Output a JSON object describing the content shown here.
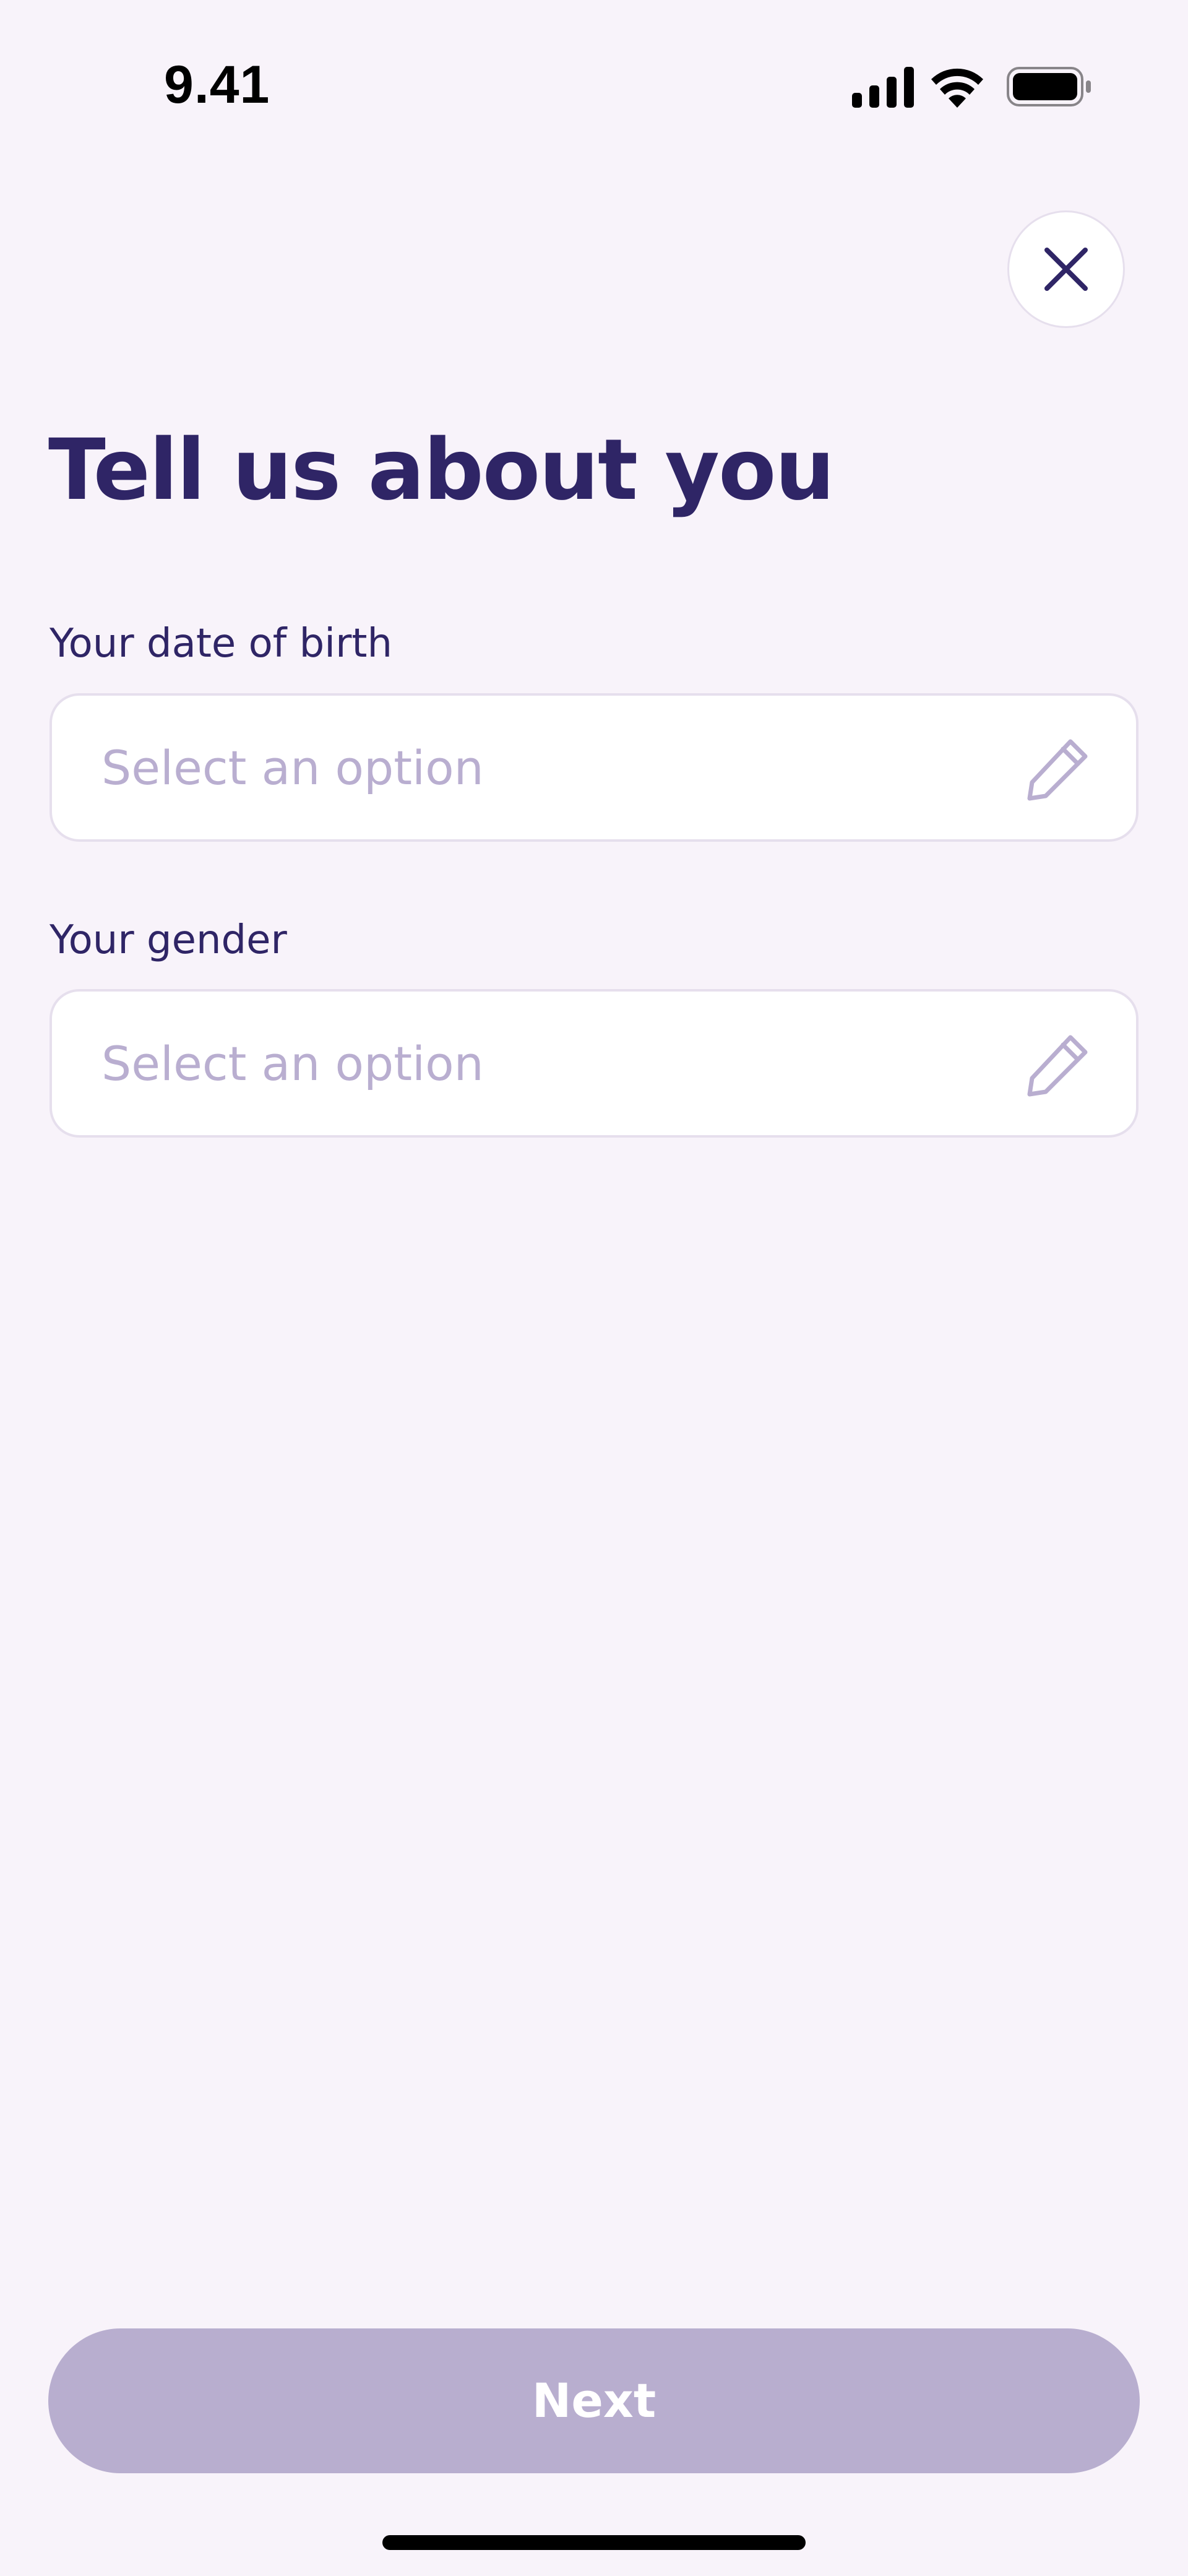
{
  "status_bar": {
    "time": "9.41",
    "icons": [
      "cellular-signal-icon",
      "wifi-icon",
      "battery-icon"
    ]
  },
  "header": {
    "close_icon": "close-icon"
  },
  "main": {
    "title": "Tell us about you",
    "fields": [
      {
        "label": "Your date of birth",
        "placeholder": "Select an option",
        "value": "",
        "icon": "pencil-icon"
      },
      {
        "label": "Your gender",
        "placeholder": "Select an option",
        "value": "",
        "icon": "pencil-icon"
      }
    ]
  },
  "footer": {
    "next_label": "Next"
  },
  "colors": {
    "background": "#f8f3fa",
    "primary_text": "#2f2566",
    "placeholder": "#b9aed0",
    "field_border": "#e6dfed",
    "button_disabled": "#b8aecf",
    "button_text": "#ffffff"
  }
}
